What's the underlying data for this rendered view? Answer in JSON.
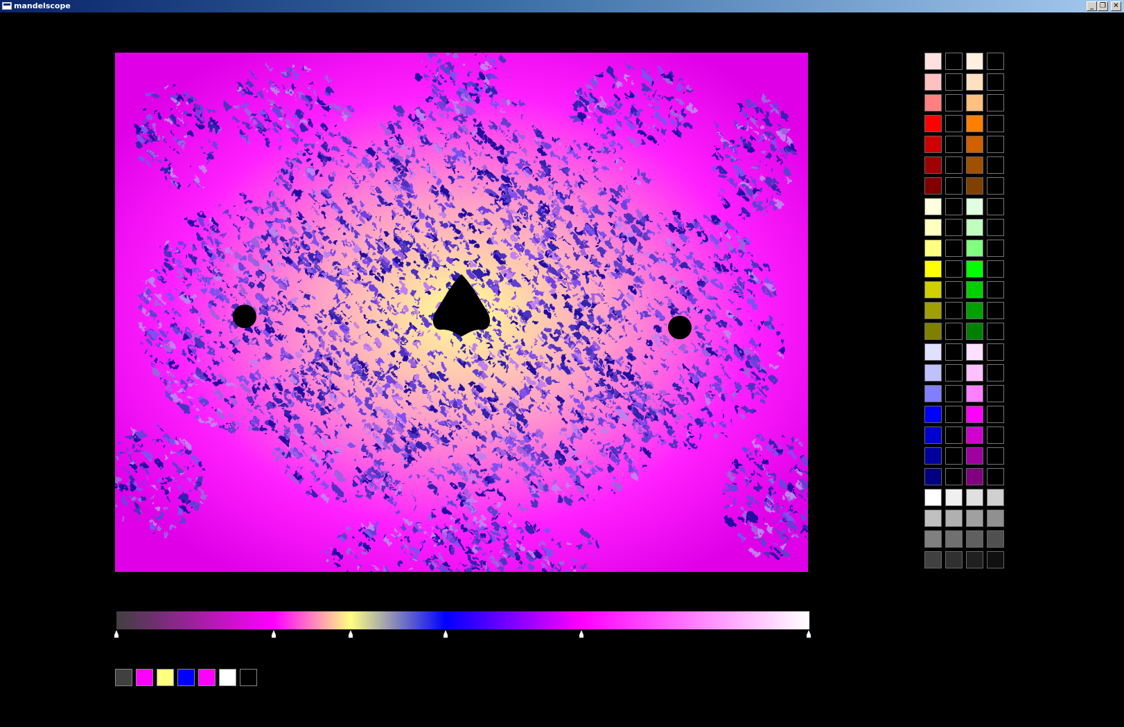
{
  "window": {
    "title": "mandelscope"
  },
  "titlebar_buttons": [
    {
      "name": "minimize-button",
      "glyph": "_"
    },
    {
      "name": "restore-button",
      "glyph": "❐"
    },
    {
      "name": "close-button",
      "glyph": "✕"
    }
  ],
  "gradient": {
    "stops": [
      {
        "pos": 0.0,
        "color": "#404040"
      },
      {
        "pos": 0.227,
        "color": "#ff00ff"
      },
      {
        "pos": 0.338,
        "color": "#ffff80"
      },
      {
        "pos": 0.475,
        "color": "#0000ff"
      },
      {
        "pos": 0.672,
        "color": "#ff00ff"
      },
      {
        "pos": 1.0,
        "color": "#ffffff"
      }
    ]
  },
  "key_colors": [
    "#404040",
    "#ff00ff",
    "#ffff80",
    "#0000ff",
    "#ff00ff",
    "#ffffff",
    "#000000"
  ],
  "palette": {
    "columns": [
      [
        "#ffe0e0",
        "#ffc0c0",
        "#ff8080",
        "#ff0000",
        "#d00000",
        "#a00000",
        "#800000",
        "#ffffe0",
        "#ffffc0",
        "#ffff80",
        "#ffff00",
        "#d0d000",
        "#a0a000",
        "#808000",
        "#e0e0ff",
        "#c0c0ff",
        "#8080ff",
        "#0000ff",
        "#0000d0",
        "#0000a0",
        "#000080",
        "#ffffff",
        "#c0c0c0",
        "#808080",
        "#404040"
      ],
      [
        "#000000",
        "#000000",
        "#000000",
        "#000000",
        "#000000",
        "#000000",
        "#000000",
        "#000000",
        "#000000",
        "#000000",
        "#000000",
        "#000000",
        "#000000",
        "#000000",
        "#000000",
        "#000000",
        "#000000",
        "#000000",
        "#000000",
        "#000000",
        "#000000",
        "#f0f0f0",
        "#b0b0b0",
        "#707070",
        "#303030"
      ],
      [
        "#fff0e0",
        "#ffe0c0",
        "#ffc080",
        "#ff8000",
        "#d06000",
        "#a05000",
        "#804000",
        "#e0ffe0",
        "#c0ffc0",
        "#80ff80",
        "#00ff00",
        "#00d000",
        "#00a000",
        "#008000",
        "#ffe0ff",
        "#ffc0ff",
        "#ff80ff",
        "#ff00ff",
        "#d000d0",
        "#a000a0",
        "#800080",
        "#e0e0e0",
        "#a0a0a0",
        "#606060",
        "#202020"
      ],
      [
        "#000000",
        "#000000",
        "#000000",
        "#000000",
        "#000000",
        "#000000",
        "#000000",
        "#000000",
        "#000000",
        "#000000",
        "#000000",
        "#000000",
        "#000000",
        "#000000",
        "#000000",
        "#000000",
        "#000000",
        "#000000",
        "#000000",
        "#000000",
        "#000000",
        "#d0d0d0",
        "#909090",
        "#505050",
        "#101010"
      ]
    ]
  },
  "fractal": {
    "set_color": "#000000",
    "background_color": "#e800e8"
  }
}
